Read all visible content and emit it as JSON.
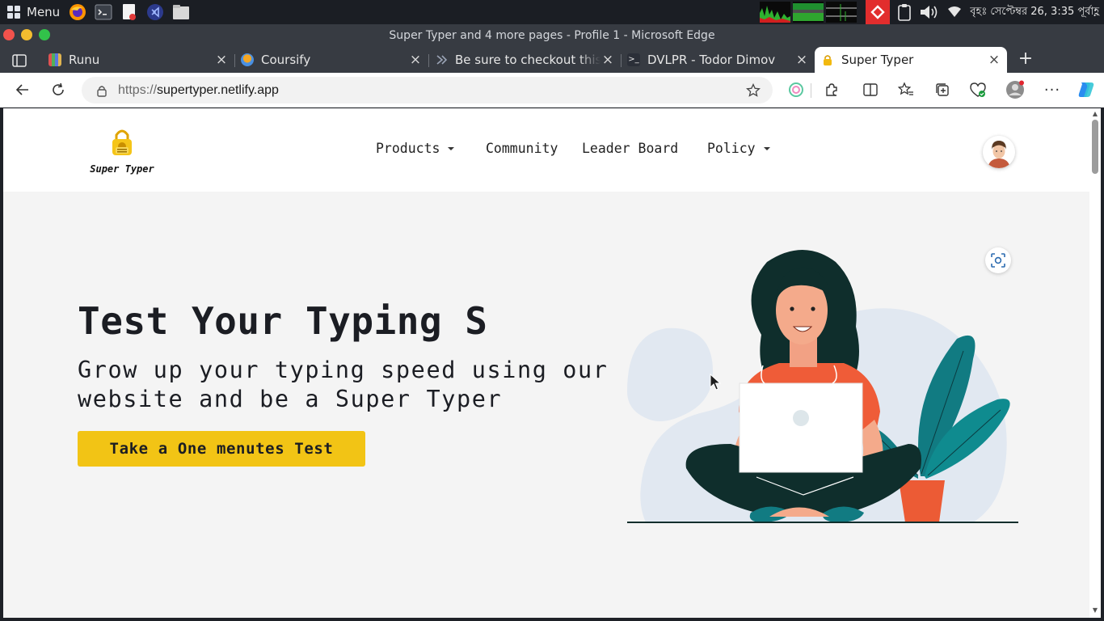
{
  "taskbar": {
    "menu_label": "Menu",
    "launchers": [
      "firefox-icon",
      "terminal-icon",
      "text-editor-icon",
      "vscode-icon",
      "files-icon"
    ],
    "clock": "বৃহঃ সেপ্টেম্বর 26,  3:35 পূর্বাহ্ণ"
  },
  "window": {
    "title": "Super Typer and 4 more pages - Profile 1 - Microsoft Edge"
  },
  "tabs": [
    {
      "title": "Runu",
      "icon": "bars-favicon",
      "active": false
    },
    {
      "title": "Coursify",
      "icon": "coursify-favicon",
      "active": false
    },
    {
      "title": "Be sure to checkout this be",
      "icon": "loading-favicon",
      "active": false
    },
    {
      "title": "DVLPR - Todor Dimov",
      "icon": "terminal-favicon",
      "active": false
    },
    {
      "title": "Super Typer",
      "icon": "super-typer-favicon",
      "active": true
    }
  ],
  "address": {
    "scheme": "https://",
    "host": "supertyper.netlify.app"
  },
  "site": {
    "brand": "Super Typer",
    "nav": {
      "products": "Products",
      "community": "Community",
      "leaderboard": "Leader Board",
      "policy": "Policy"
    },
    "hero": {
      "title": "Test Your Typing S",
      "subtitle": "Grow up your typing speed using our website and be a Super Typer",
      "cta": "Take a One menutes Test"
    }
  },
  "colors": {
    "accent": "#f2c415",
    "page_bg": "#f4f4f4",
    "dark_text": "#1b1d23",
    "illustration_orange": "#f0603a",
    "illustration_teal": "#127f86",
    "illustration_dark": "#11312f"
  }
}
